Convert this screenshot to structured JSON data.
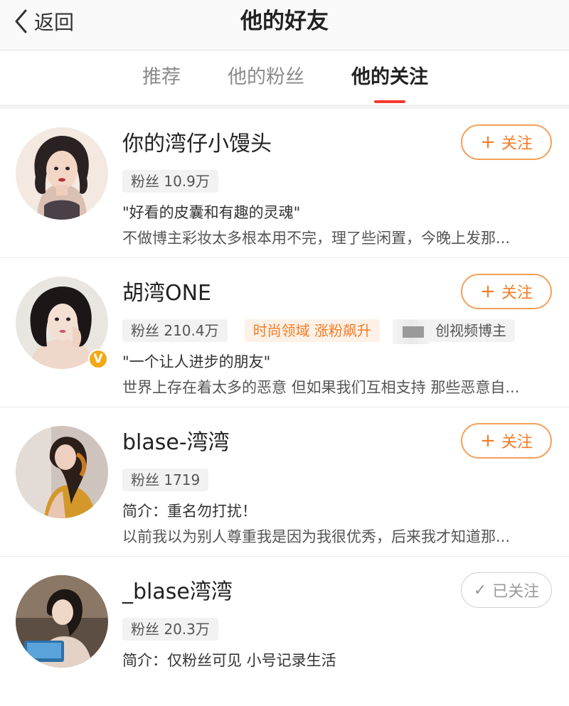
{
  "nav": {
    "back_label": "返回",
    "title": "他的好友"
  },
  "tabs": [
    {
      "label": "推荐",
      "active": false
    },
    {
      "label": "他的粉丝",
      "active": false
    },
    {
      "label": "他的关注",
      "active": true
    }
  ],
  "colors": {
    "accent": "#f47c25",
    "tab_indicator": "#f53a2f",
    "badge": "#f2a917"
  },
  "users": [
    {
      "name": "你的湾仔小馒头",
      "fans": "粉丝 10.9万",
      "bio1": "\"好看的皮囊和有趣的灵魂\"",
      "bio2": "不做博主彩妆太多根本用不完，理了些闲置，今晚上发那...",
      "button": "关注",
      "button_icon": "plus-icon"
    },
    {
      "name": "胡湾ONE",
      "fans": "粉丝 210.4万",
      "tag_hot": "时尚领域 涨粉飙升",
      "tag_role": "创视频博主",
      "verified": true,
      "bio1": "\"一个让人进步的朋友\"",
      "bio2": "世界上存在着太多的恶意 但如果我们互相支持 那些恶意自...",
      "button": "关注",
      "button_icon": "plus-icon"
    },
    {
      "name": "blase-湾湾",
      "fans": "粉丝 1719",
      "bio1": "简介：重名勿打扰！",
      "bio2": "以前我以为别人尊重我是因为我很优秀，后来我才知道那...",
      "button": "关注",
      "button_icon": "plus-icon"
    },
    {
      "name": "_blase湾湾",
      "fans": "粉丝 20.3万",
      "bio1": "简介：仅粉丝可见 小号记录生活",
      "button": "已关注",
      "button_icon": "check-icon"
    }
  ]
}
